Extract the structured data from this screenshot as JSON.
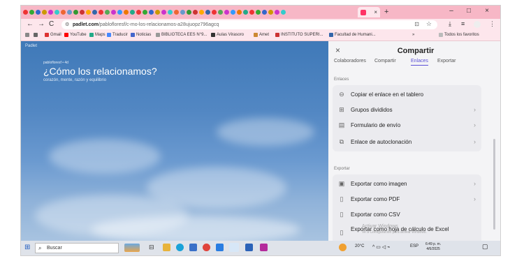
{
  "browser": {
    "tab_close": "×",
    "new_tab": "+",
    "window_controls": [
      "–",
      "□",
      "×"
    ],
    "url_host": "padlet.com",
    "url_path": "/pablofloresf/c-mo-los-relacionamos-a28ujuopz796agcq",
    "nav": [
      "←",
      "→",
      "C"
    ],
    "tools": [
      "⊡",
      "☆",
      "⤓",
      "≡",
      "⋮"
    ],
    "bookmarks": [
      "Gmail",
      "YouTube",
      "Maps",
      "Traducir",
      "Noticias",
      "BIBLIOTECA EES N°9...",
      "Aulas Virasoro",
      "Amet",
      "INSTITUTO SUPERI...",
      "Facultad de Humani..."
    ],
    "bookmarks_more": "»",
    "all_favorites": "Todos los favoritos"
  },
  "padlet": {
    "brand": "Padlet",
    "author": "pablofloresf • 4d",
    "title": "¿Cómo los relacionamos?",
    "subtitle": "corazón, mente, razón y equilibrio"
  },
  "panel": {
    "close": "×",
    "title": "Compartir",
    "tabs": [
      "Colaboradores",
      "Compartir",
      "Enlaces",
      "Exportar"
    ],
    "active_tab": "Enlaces",
    "links_label": "Enlaces",
    "links": [
      {
        "icon": "link-icon",
        "glyph": "⊖",
        "label": "Copiar el enlace en el tablero",
        "chevron": ""
      },
      {
        "icon": "grid-icon",
        "glyph": "⊞",
        "label": "Grupos divididos",
        "chevron": "›"
      },
      {
        "icon": "form-icon",
        "glyph": "▤",
        "label": "Formulario de envío",
        "chevron": "›"
      },
      {
        "icon": "clone-icon",
        "glyph": "⧉",
        "label": "Enlace de autoclonación",
        "chevron": "›"
      }
    ],
    "export_label": "Exportar",
    "exports": [
      {
        "icon": "image-icon",
        "glyph": "▣",
        "label": "Exportar como imagen",
        "chevron": "›"
      },
      {
        "icon": "pdf-icon",
        "glyph": "▯",
        "label": "Exportar como PDF",
        "chevron": "›"
      },
      {
        "icon": "csv-icon",
        "glyph": "▯",
        "label": "Exportar como CSV",
        "chevron": ""
      },
      {
        "icon": "excel-icon",
        "glyph": "▯",
        "label": "Exportar como hoja de cálculo de Excel",
        "chevron": ""
      }
    ],
    "watermark_line1": "Activar Windows",
    "watermark_line2": "Ve a Configuración para activar Windows."
  },
  "taskbar": {
    "search_placeholder": "Buscar",
    "weather": "20°C",
    "lang": "ESP",
    "time": "6:49 p. m.",
    "date": "4/6/2025"
  },
  "colors": {
    "chrome_pink": "#f7b7c6",
    "accent": "#5b50d6",
    "panel_bg": "#f4f4f6"
  }
}
